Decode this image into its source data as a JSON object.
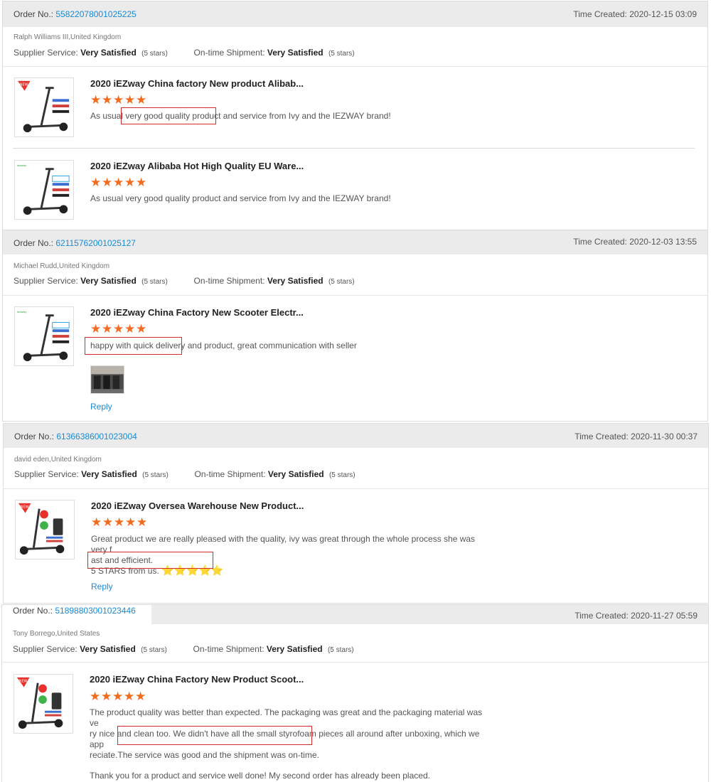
{
  "labels": {
    "order_no": "Order No.:",
    "time_created": "Time Created:",
    "supplier_service": "Supplier Service:",
    "ontime_shipment": "On-time Shipment:",
    "reply": "Reply"
  },
  "orders": [
    {
      "number": "55822078001025225",
      "time": "2020-12-15 03:09",
      "buyer": "Ralph Williams III,United Kingdom",
      "supplier_service": "Very Satisfied",
      "supplier_stars": "(5 stars)",
      "shipment": "Very Satisfied",
      "shipment_stars": "(5 stars)",
      "products": [
        {
          "title": "2020 iEZway China factory New product Alibab...",
          "rating": 5,
          "comment": "As usual very good quality product and service from Ivy and the IEZWAY brand!"
        },
        {
          "title": "2020 iEZway Alibaba Hot High Quality EU Ware...",
          "rating": 5,
          "comment": "As usual very good quality product and service from Ivy and the IEZWAY brand!"
        }
      ]
    },
    {
      "number": "62115762001025127",
      "time": "2020-12-03 13:55",
      "buyer": "Michael Rudd,United Kingdom",
      "supplier_service": "Very Satisfied",
      "supplier_stars": "(5 stars)",
      "shipment": "Very Satisfied",
      "shipment_stars": "(5 stars)",
      "products": [
        {
          "title": "2020 iEZway China Factory New Scooter Electr...",
          "rating": 5,
          "comment": "happy with quick delivery and product, great communication with seller"
        }
      ]
    },
    {
      "number": "61366386001023004",
      "time": "2020-11-30 00:37",
      "buyer": "david eden,United Kingdom",
      "supplier_service": "Very Satisfied",
      "supplier_stars": "(5 stars)",
      "shipment": "Very Satisfied",
      "shipment_stars": "(5 stars)",
      "products": [
        {
          "title": "2020 iEZway Oversea Warehouse New Product...",
          "rating": 5,
          "comment_line1": "Great product we are really pleased with the quality, ivy was great through the whole process she was very f",
          "comment_line2": "ast and efficient.",
          "comment_line3": "5 STARS from us."
        }
      ]
    },
    {
      "number": "51898803001023446",
      "time": "2020-11-27 05:59",
      "buyer": "Tony Borrego,United States",
      "supplier_service": "Very Satisfied",
      "supplier_stars": "(5 stars)",
      "shipment": "Very Satisfied",
      "shipment_stars": "(5 stars)",
      "products": [
        {
          "title": "2020 iEZway China Factory New Product Scoot...",
          "rating": 5,
          "comment_line1": "The product quality was better than expected. The packaging was great and the packaging material was ve",
          "comment_line2": "ry nice and clean too. We didn't have all the small styrofoam pieces all around after unboxing, which we app",
          "comment_line3a": "reciate.",
          "comment_line3b": "The service was good and the shipment was on-time.",
          "comment_line4": "Thank you for a product and service well done! My second order has already been placed."
        }
      ]
    }
  ],
  "icons": {
    "star": "★",
    "emoji_star": "⭐"
  },
  "colors": {
    "accent_link": "#1a8ad4",
    "star_orange": "#f26c1f",
    "highlight_red": "#d12c2c",
    "header_bg": "#ebebeb"
  }
}
